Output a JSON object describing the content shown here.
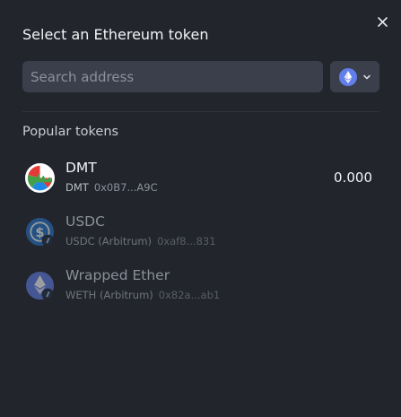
{
  "header": {
    "title": "Select an Ethereum token"
  },
  "search": {
    "placeholder": "Search address",
    "value": ""
  },
  "network_selector": {
    "icon": "ethereum-icon"
  },
  "section": {
    "label": "Popular tokens"
  },
  "tokens": [
    {
      "name": "DMT",
      "symbol": "DMT",
      "address": "0x0B7...A9C",
      "balance": "0.000",
      "icon": "dmt-token-icon"
    },
    {
      "name": "USDC",
      "symbol": "USDC (Arbitrum)",
      "address": "0xaf8...831",
      "icon": "usdc-token-icon"
    },
    {
      "name": "Wrapped Ether",
      "symbol": "WETH (Arbitrum)",
      "address": "0x82a...ab1",
      "icon": "weth-token-icon"
    }
  ],
  "colors": {
    "background": "#22252c",
    "input_bg": "#3a3f4b",
    "ethereum_blue": "#627eea",
    "usdc_blue": "#2775ca"
  }
}
